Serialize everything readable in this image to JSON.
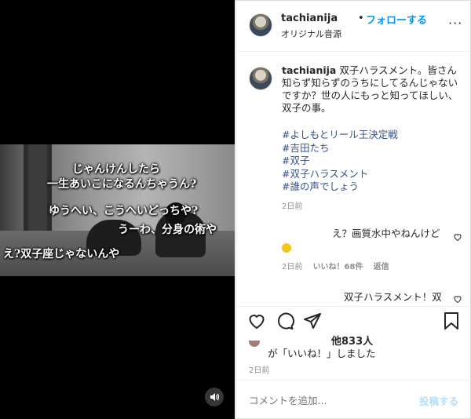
{
  "post": {
    "username": "tachianija",
    "follow_label": "フォローする",
    "audio_label": "オリジナル音源",
    "more_label": "···"
  },
  "video": {
    "subtitles": [
      "じゃんけんしたら",
      "一生あいこになるんちゃうん?",
      "ゆうへい、こうへいどっちや?",
      "うーわ、分身の術や",
      "え?双子座じゃないんや"
    ]
  },
  "caption": {
    "username": "tachianija",
    "text": "双子ハラスメント。皆さん知らず知らずのうちにしてるんじゃないですか？世の人にもっと知ってほしい、双子の事。",
    "hashtags": [
      "#よしもとリール王決定戦",
      "#吉田たち",
      "#双子",
      "#双子ハラスメント",
      "#誰の声でしょう"
    ],
    "time": "2日前"
  },
  "comments": [
    {
      "text": "え？画質水中やねんけど",
      "time": "2日前",
      "likes": "いいね！68件",
      "reply": "返信"
    },
    {
      "text": "双子ハラスメント！双"
    }
  ],
  "likes": {
    "count": "他833人",
    "liked_text": "が「いいね！」しました",
    "time": "2日前"
  },
  "comment_box": {
    "placeholder": "コメントを追加...",
    "post_label": "投稿する"
  },
  "colors": {
    "accent": "#0095f6",
    "hashtag": "#385185",
    "muted": "#8e8e8e"
  }
}
